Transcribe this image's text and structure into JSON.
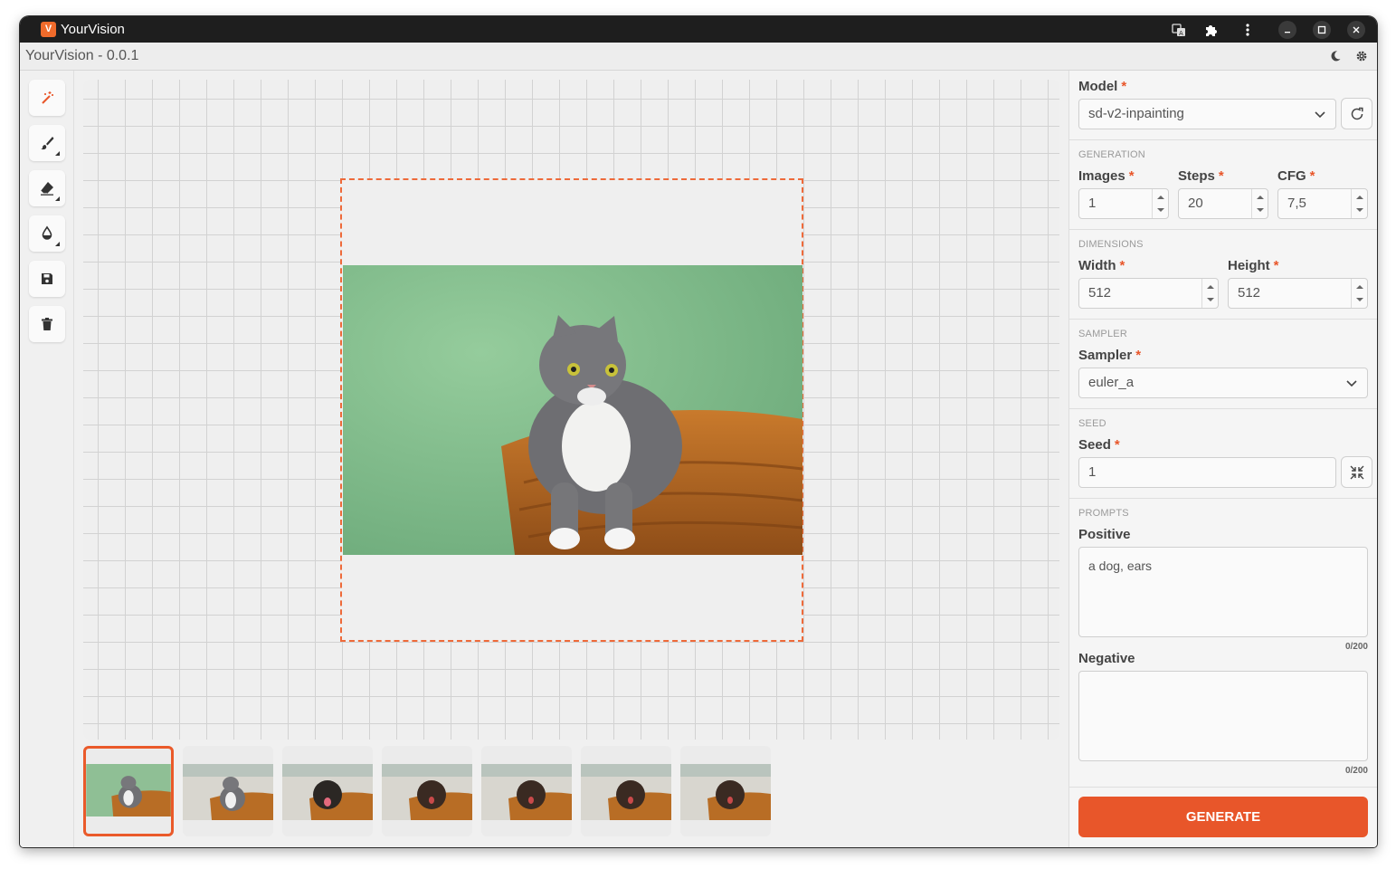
{
  "window": {
    "title": "YourVision",
    "logo_glyph": "V"
  },
  "titlebar_icons": [
    "translate-icon",
    "extension-puzzle-icon",
    "kebab-menu-icon"
  ],
  "window_controls": [
    "minimize-icon",
    "maximize-icon",
    "close-icon"
  ],
  "app": {
    "title": "YourVision - 0.0.1"
  },
  "menubar_icons": [
    "dark-mode-moon-icon",
    "settings-gear-icon"
  ],
  "tools": [
    {
      "name": "magic-wand",
      "active": true
    },
    {
      "name": "brush",
      "active": false
    },
    {
      "name": "eraser",
      "active": false
    },
    {
      "name": "fill-drop",
      "active": false
    },
    {
      "name": "save",
      "active": false
    },
    {
      "name": "delete",
      "active": false
    }
  ],
  "colors": {
    "accent": "#e8562a",
    "selection_border": "#ee6a3a",
    "thumb_selected": "#ea5a2a"
  },
  "thumbnails": [
    {
      "subject": "cat",
      "selected": true
    },
    {
      "subject": "cat",
      "selected": false
    },
    {
      "subject": "dog",
      "selected": false
    },
    {
      "subject": "dog",
      "selected": false
    },
    {
      "subject": "dog",
      "selected": false
    },
    {
      "subject": "dog",
      "selected": false
    },
    {
      "subject": "dog",
      "selected": false
    }
  ],
  "panel": {
    "model": {
      "label": "Model",
      "required": "*",
      "value": "sd-v2-inpainting"
    },
    "generation": {
      "heading": "GENERATION",
      "images": {
        "label": "Images",
        "required": "*",
        "value": "1"
      },
      "steps": {
        "label": "Steps",
        "required": "*",
        "value": "20"
      },
      "cfg": {
        "label": "CFG",
        "required": "*",
        "value": "7,5"
      }
    },
    "dimensions": {
      "heading": "DIMENSIONS",
      "width": {
        "label": "Width",
        "required": "*",
        "value": "512"
      },
      "height": {
        "label": "Height",
        "required": "*",
        "value": "512"
      }
    },
    "sampler": {
      "heading": "SAMPLER",
      "label": "Sampler",
      "required": "*",
      "value": "euler_a"
    },
    "seed": {
      "heading": "SEED",
      "label": "Seed",
      "required": "*",
      "value": "1"
    },
    "prompts": {
      "heading": "PROMPTS",
      "positive": {
        "label": "Positive",
        "value": "a dog, ears",
        "counter": "0/200"
      },
      "negative": {
        "label": "Negative",
        "value": "",
        "counter": "0/200"
      }
    },
    "generate_label": "GENERATE"
  }
}
